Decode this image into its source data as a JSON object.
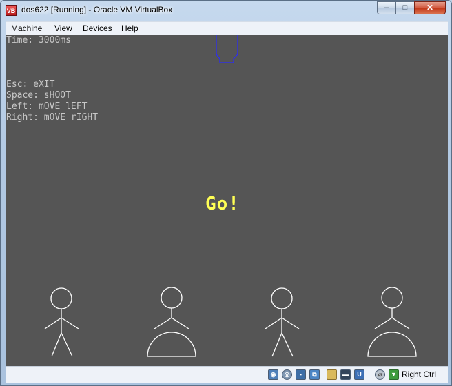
{
  "window": {
    "title": "dos622 [Running] - Oracle VM VirtualBox",
    "app_icon": "virtualbox-icon"
  },
  "controls": {
    "minimize": "–",
    "maximize": "□",
    "close": "✕"
  },
  "menu": [
    "Machine",
    "View",
    "Devices",
    "Help"
  ],
  "guest": {
    "time_label": "Time: 3000ms",
    "help_lines": [
      "Esc: eXIT",
      "Space: sHOOT",
      "Left: mOVE lEFT",
      "Right: mOVE rIGHT"
    ],
    "go_text": "Go!",
    "colors": {
      "background": "#555555",
      "text": "#c8c8c8",
      "go": "#ffff55",
      "figures": "#ffffff",
      "ship": "#2a2aff"
    }
  },
  "statusbar": {
    "icons": [
      "hard-disk-icon",
      "optical-drive-icon",
      "floppy-icon",
      "network-icon",
      "shared-folders-icon",
      "display-icon",
      "usb-icon",
      "mouse-integration-icon",
      "keyboard-capture-icon"
    ],
    "host_key": "Right Ctrl"
  }
}
